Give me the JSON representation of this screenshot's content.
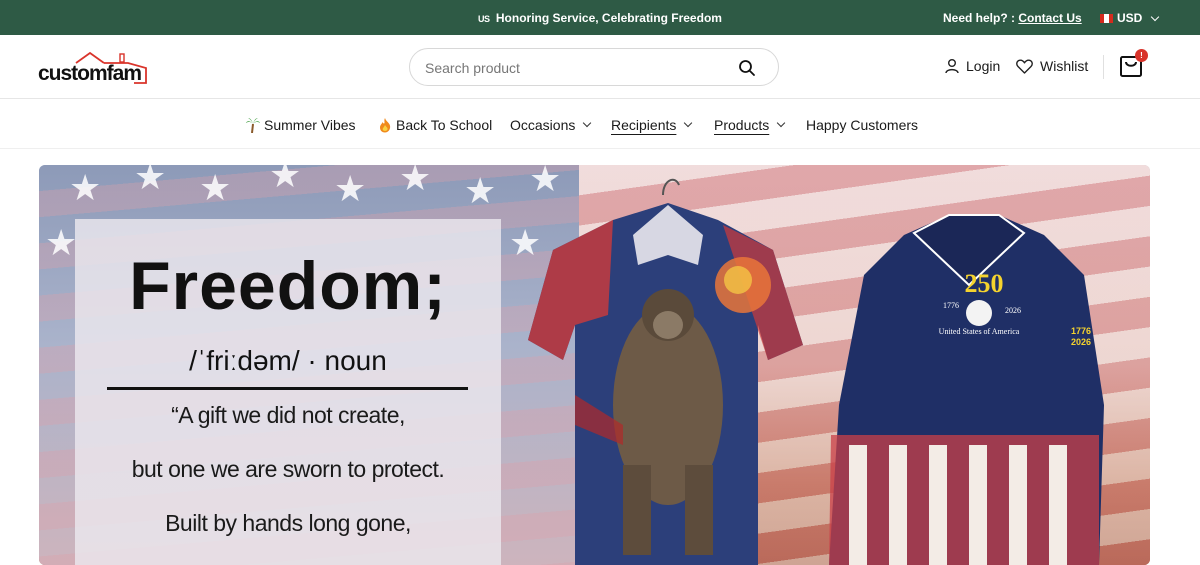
{
  "topbar": {
    "flag_text": "US",
    "announcement": "Honoring Service, Celebrating Freedom",
    "help_label": "Need help? :",
    "contact_label": "Contact Us",
    "currency": "USD"
  },
  "header": {
    "logo_text": "customfam",
    "search_placeholder": "Search product",
    "login_label": "Login",
    "wishlist_label": "Wishlist",
    "cart_count": "!"
  },
  "nav": {
    "items": [
      {
        "label": "Summer Vibes",
        "icon": "palm-tree-icon"
      },
      {
        "label": "Back To School",
        "icon": "fire-icon"
      },
      {
        "label": "Occasions"
      },
      {
        "label": "Recipients"
      },
      {
        "label": "Products"
      },
      {
        "label": "Happy Customers"
      }
    ]
  },
  "banner": {
    "title": "Freedom;",
    "phonetic": "/ˈfriːdəm/ · noun",
    "quote_lines": [
      "“A gift we did not create,",
      "but one we are sworn to protect.",
      "Built by hands long gone,"
    ],
    "shirt_right": {
      "number": "250",
      "year_start": "1776",
      "year_end": "2026",
      "caption": "United States of America",
      "sleeve_top": "1776",
      "sleeve_bottom": "2026"
    }
  },
  "colors": {
    "topbar_bg": "#2e5a45",
    "badge": "#d9342b"
  }
}
